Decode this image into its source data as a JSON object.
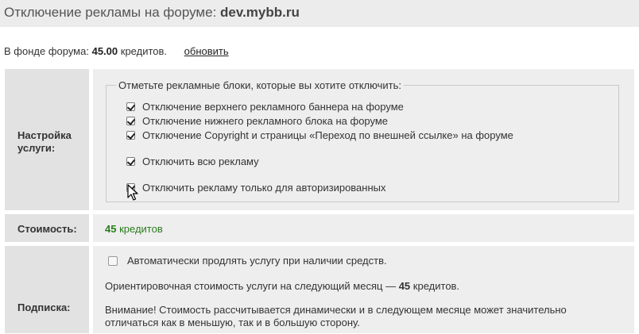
{
  "header": {
    "title": "Отключение рекламы на форуме:",
    "domain": "dev.mybb.ru"
  },
  "fund": {
    "prefix": "В фонде форума:",
    "amount": "45.00",
    "suffix": "кредитов.",
    "refresh_link": "обновить"
  },
  "settings": {
    "label": "Настройка услуги:",
    "legend": "Отметьте рекламные блоки, которые вы хотите отключить:",
    "options": [
      {
        "label": "Отключение верхнего рекламного баннера на форуме",
        "checked": true
      },
      {
        "label": "Отключение нижнего рекламного блока на форуме",
        "checked": true
      },
      {
        "label": "Отключение Copyright и страницы «Переход по внешней ссылке» на форуме",
        "checked": true
      },
      {
        "label": "Отключить всю рекламу",
        "checked": true
      },
      {
        "label": "Отключить рекламу только для авторизированных",
        "checked": true
      }
    ]
  },
  "cost": {
    "label": "Стоимость:",
    "amount": "45",
    "unit": "кредитов"
  },
  "subscription": {
    "label": "Подписка:",
    "auto_renew": {
      "label": "Автоматически продлять услугу при наличии средств.",
      "checked": false
    },
    "estimate_prefix": "Ориентировочная стоимость услуги на следующий месяц —",
    "estimate_amount": "45",
    "estimate_suffix": "кредитов.",
    "warning_line1": "Внимание! Стоимость рассчитывается динамически и в следующем месяце может значительно",
    "warning_line2": "отличаться как в меньшую, так и в большую сторону."
  },
  "colors": {
    "header_bg": "#ececec",
    "label_bg": "#e2e2e2",
    "value_bg": "#eeeeee",
    "price_green": "#2a7d1e"
  },
  "icons": {
    "checkbox": "checkbox-icon",
    "cursor": "mouse-pointer-icon"
  }
}
